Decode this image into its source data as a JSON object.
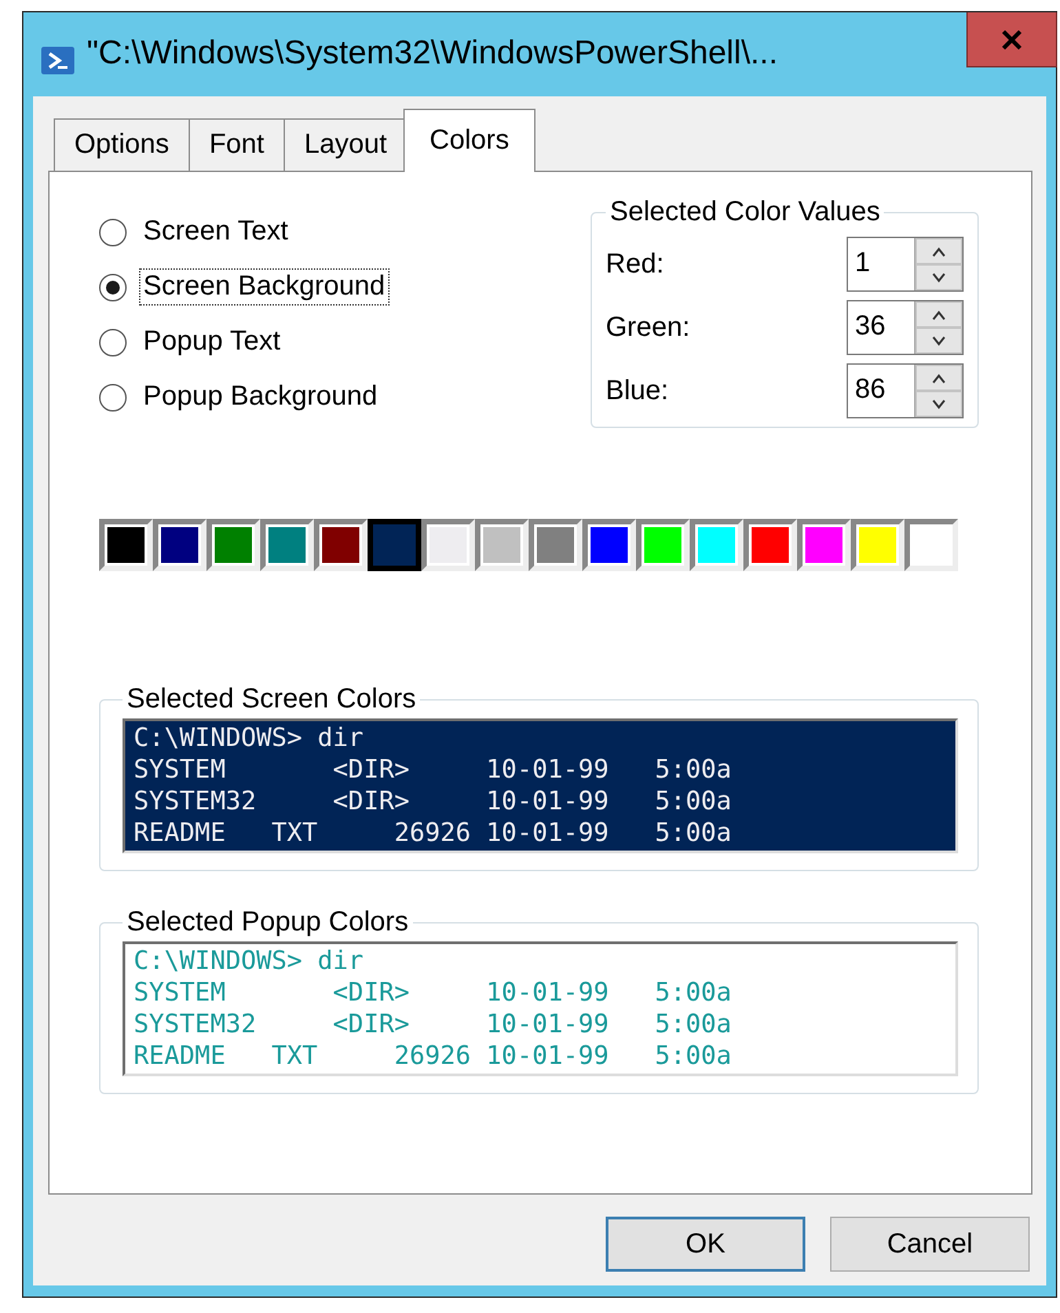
{
  "window": {
    "title": "\"C:\\Windows\\System32\\WindowsPowerShell\\..."
  },
  "tabs": [
    {
      "label": "Options",
      "selected": false
    },
    {
      "label": "Font",
      "selected": false
    },
    {
      "label": "Layout",
      "selected": false
    },
    {
      "label": "Colors",
      "selected": true
    }
  ],
  "targets": [
    {
      "label": "Screen Text",
      "selected": false
    },
    {
      "label": "Screen Background",
      "selected": true
    },
    {
      "label": "Popup Text",
      "selected": false
    },
    {
      "label": "Popup Background",
      "selected": false
    }
  ],
  "color_values": {
    "title": "Selected Color Values",
    "fields": [
      {
        "label": "Red:",
        "value": "1"
      },
      {
        "label": "Green:",
        "value": "36"
      },
      {
        "label": "Blue:",
        "value": "86"
      }
    ]
  },
  "palette": [
    {
      "color": "#000000",
      "selected": false
    },
    {
      "color": "#000080",
      "selected": false
    },
    {
      "color": "#008000",
      "selected": false
    },
    {
      "color": "#008080",
      "selected": false
    },
    {
      "color": "#800000",
      "selected": false
    },
    {
      "color": "#012456",
      "selected": true
    },
    {
      "color": "#eeedf0",
      "selected": false
    },
    {
      "color": "#c0c0c0",
      "selected": false
    },
    {
      "color": "#808080",
      "selected": false
    },
    {
      "color": "#0000ff",
      "selected": false
    },
    {
      "color": "#00ff00",
      "selected": false
    },
    {
      "color": "#00ffff",
      "selected": false
    },
    {
      "color": "#ff0000",
      "selected": false
    },
    {
      "color": "#ff00ff",
      "selected": false
    },
    {
      "color": "#ffff00",
      "selected": false
    },
    {
      "color": "#ffffff",
      "selected": false
    }
  ],
  "previews": [
    {
      "kind": "screen",
      "title": "Selected Screen Colors",
      "lines": [
        "C:\\WINDOWS> dir",
        "SYSTEM       <DIR>     10-01-99   5:00a",
        "SYSTEM32     <DIR>     10-01-99   5:00a",
        "README   TXT     26926 10-01-99   5:00a"
      ]
    },
    {
      "kind": "popup",
      "title": "Selected Popup Colors",
      "lines": [
        "C:\\WINDOWS> dir",
        "SYSTEM       <DIR>     10-01-99   5:00a",
        "SYSTEM32     <DIR>     10-01-99   5:00a",
        "README   TXT     26926 10-01-99   5:00a"
      ]
    }
  ],
  "buttons": [
    {
      "label": "OK",
      "default": true
    },
    {
      "label": "Cancel",
      "default": false
    }
  ]
}
